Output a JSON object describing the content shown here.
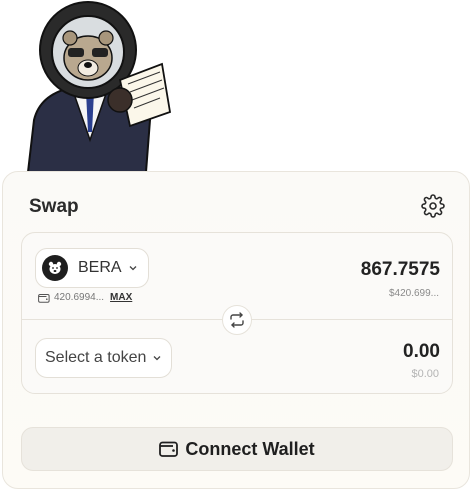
{
  "swap": {
    "title": "Swap",
    "settings_icon": "gear-icon"
  },
  "from": {
    "token_symbol": "BERA",
    "token_icon": "bear-logo-icon",
    "balance": "420.6994...",
    "max_label": "MAX",
    "amount": "867.7575",
    "usd_value": "$420.699..."
  },
  "to": {
    "select_label": "Select a token",
    "amount": "0.00",
    "usd_value": "$0.00"
  },
  "switch_icon": "swap-arrows-icon",
  "connect": {
    "label": "Connect Wallet",
    "icon": "wallet-icon"
  },
  "colors": {
    "card_bg": "#fbfaf7",
    "border": "#e6e2da",
    "button_bg": "#f1efea",
    "text": "#1f1f1f"
  }
}
